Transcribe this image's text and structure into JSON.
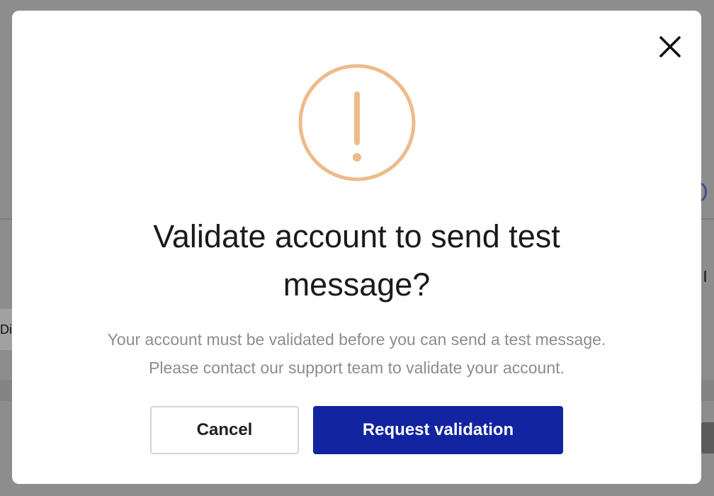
{
  "modal": {
    "title": "Validate account to send test message?",
    "description_line1": "Your account must be validated before you can send a test message.",
    "description_line2": "Please contact our support team to validate your account.",
    "cancel_label": "Cancel",
    "primary_label": "Request validation",
    "warning_icon": "exclamation-circle-icon",
    "close_icon": "close-icon",
    "warning_color": "#EDBB8A",
    "primary_color": "#1224A0"
  },
  "background": {
    "left_tab_text": "Di"
  }
}
